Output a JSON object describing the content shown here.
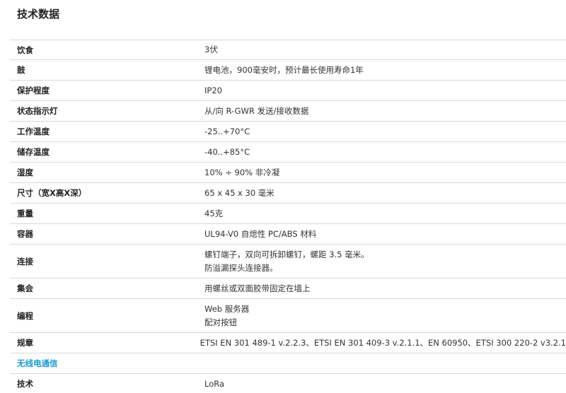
{
  "page": {
    "title": "技术数据"
  },
  "rows": [
    {
      "label": "饮食",
      "lines": [
        "3伏"
      ]
    },
    {
      "label": "鼓",
      "lines": [
        "锂电池，900毫安时，预计最长使用寿命1年"
      ]
    },
    {
      "label": "保护程度",
      "lines": [
        "IP20"
      ]
    },
    {
      "label": "状态指示灯",
      "lines": [
        "从/向 R-GWR 发送/接收数据"
      ]
    },
    {
      "label": "工作温度",
      "lines": [
        "-25..+70°C"
      ]
    },
    {
      "label": "储存温度",
      "lines": [
        "-40..+85°C"
      ]
    },
    {
      "label": "湿度",
      "lines": [
        "10% ÷ 90% 非冷凝"
      ]
    },
    {
      "label": "尺寸（宽X高X深）",
      "lines": [
        "65 x 45 x 30 毫米"
      ]
    },
    {
      "label": "重量",
      "lines": [
        "45克"
      ]
    },
    {
      "label": "容器",
      "lines": [
        "UL94-V0 自熄性 PC/ABS 材料"
      ]
    },
    {
      "label": "连接",
      "lines": [
        "螺钉端子，双向可拆卸螺钉，螺距 3.5 毫米。",
        "防溢漏探头连接器。"
      ]
    },
    {
      "label": "集会",
      "lines": [
        "用螺丝或双面胶带固定在墙上"
      ]
    },
    {
      "label": "编程",
      "lines": [
        "Web 服务器",
        "配对按钮"
      ]
    },
    {
      "label": "规章",
      "lines": [
        "ETSI EN 301 489-1 v.2.2.3、ETSI EN 301 409-3 v.2.1.1、EN 60950、ETSI 300 220-2 v3.2.1"
      ]
    }
  ],
  "section": {
    "label": "无线电通信",
    "color": "#1a9ad6"
  },
  "section_rows": [
    {
      "label": "技术",
      "lines": [
        "LoRa"
      ]
    }
  ]
}
